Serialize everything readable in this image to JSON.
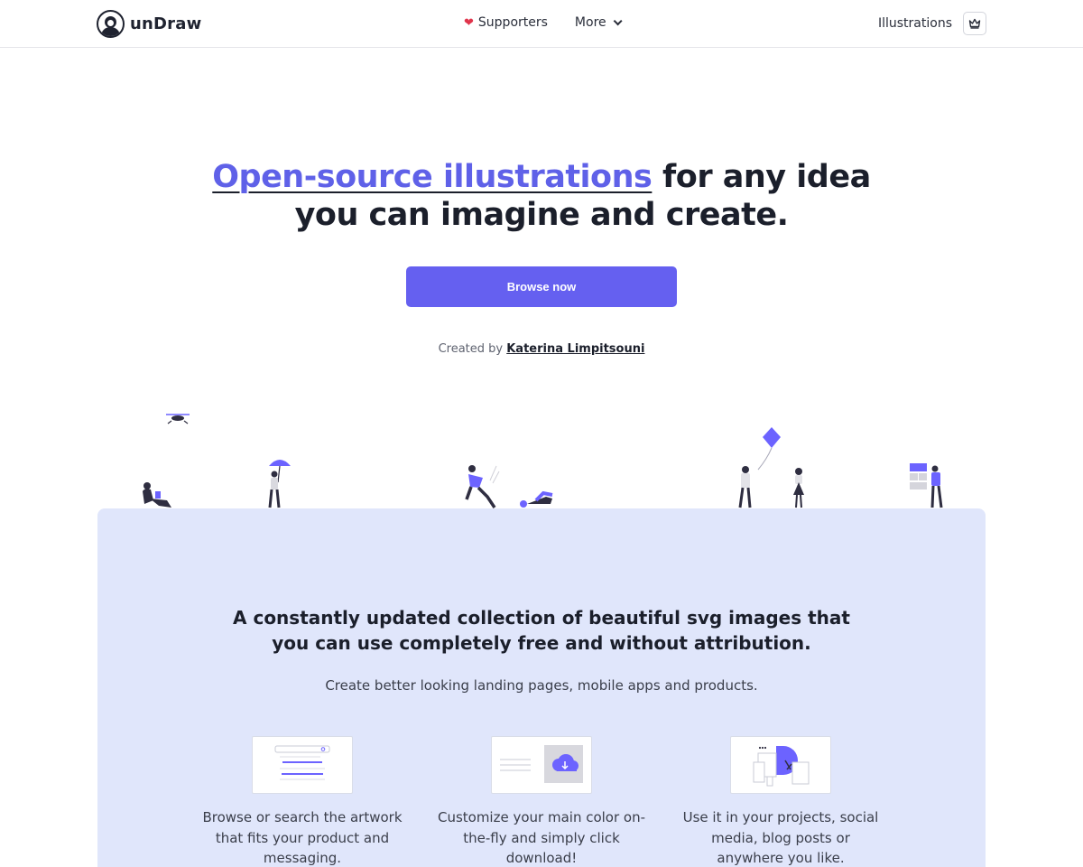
{
  "header": {
    "logo_text": "unDraw",
    "nav": {
      "supporters_label": "Supporters",
      "more_label": "More"
    },
    "right": {
      "illustrations_label": "Illustrations"
    }
  },
  "hero": {
    "title_accent": "Open-source illustrations",
    "title_rest_line1": " for any idea",
    "title_line2": "you can imagine and create.",
    "browse_button": "Browse now",
    "credit_prefix": "Created by ",
    "credit_author": "Katerina Limpitsouni"
  },
  "panel": {
    "title_line1": "A constantly updated collection of beautiful svg images that",
    "title_line2": "you can use completely free and without attribution.",
    "subtitle": "Create better looking landing pages, mobile apps and products.",
    "features": [
      {
        "text": "Browse or search the artwork that fits your product and messaging."
      },
      {
        "text": "Customize your main color on-the-fly and simply click download!"
      },
      {
        "text": "Use it in your projects, social media, blog posts or anywhere you like."
      }
    ]
  },
  "colors": {
    "accent": "#6560f0",
    "panel_bg": "#e0e6fb",
    "text_dark": "#1b1f2b",
    "heart": "#e0344b"
  },
  "icons": [
    "undraw-logo-icon",
    "heart-icon",
    "chevron-down-icon",
    "crown-icon"
  ]
}
